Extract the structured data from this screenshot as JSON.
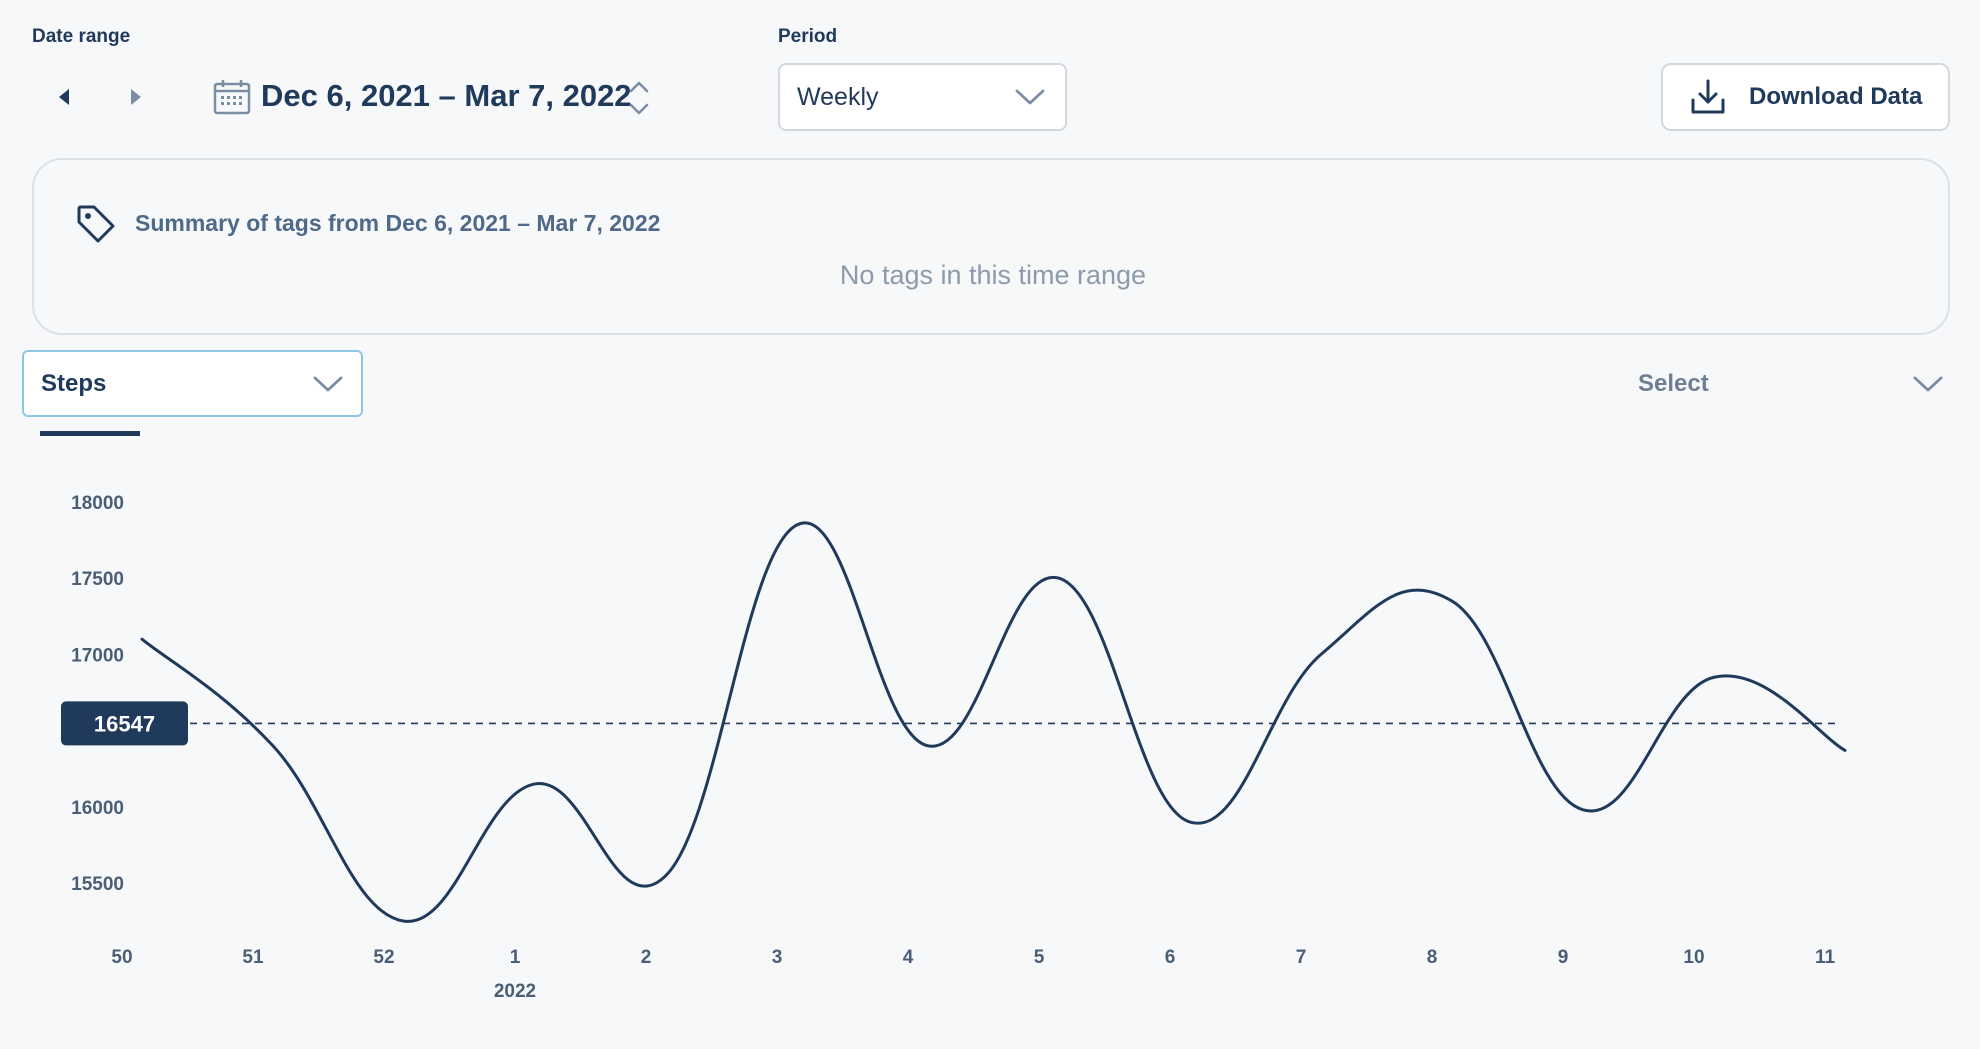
{
  "date_range": {
    "label": "Date range",
    "value": "Dec 6, 2021 – Mar 7, 2022"
  },
  "period": {
    "label": "Period",
    "selected": "Weekly"
  },
  "download": {
    "label": "Download Data"
  },
  "tags_summary": {
    "title": "Summary of tags from Dec 6, 2021 – Mar 7, 2022",
    "empty_message": "No tags in this time range"
  },
  "metric": {
    "selected": "Steps"
  },
  "compare": {
    "placeholder": "Select"
  },
  "chart_data": {
    "type": "line",
    "x": [
      "50",
      "51",
      "52",
      "1",
      "2",
      "3",
      "4",
      "5",
      "6",
      "7",
      "8",
      "9",
      "10",
      "11"
    ],
    "x_sub_labels": [
      {
        "under": "1",
        "text": "2022"
      }
    ],
    "values": [
      17100,
      16400,
      15250,
      16150,
      15550,
      17850,
      16400,
      17500,
      15900,
      17000,
      17350,
      15980,
      16850,
      16370
    ],
    "reference_line": {
      "value": 16547,
      "label": "16547",
      "style": "dashed"
    },
    "y_ticks": [
      15500,
      16000,
      16500,
      17000,
      17500,
      18000
    ],
    "y_tick_labels": [
      "15500",
      "16000",
      "17000",
      "17500",
      "18000"
    ],
    "ylim": [
      15150,
      18100
    ],
    "curve": "smooth",
    "colors": {
      "line": "#203a5c",
      "badge": "#203a5c",
      "badge_text": "#ffffff"
    }
  },
  "colors": {
    "primary": "#203a5c",
    "muted": "#8c9aab",
    "border": "#d3d8df",
    "accent_border": "#8cc8e2",
    "background": "#f7f8fa"
  }
}
